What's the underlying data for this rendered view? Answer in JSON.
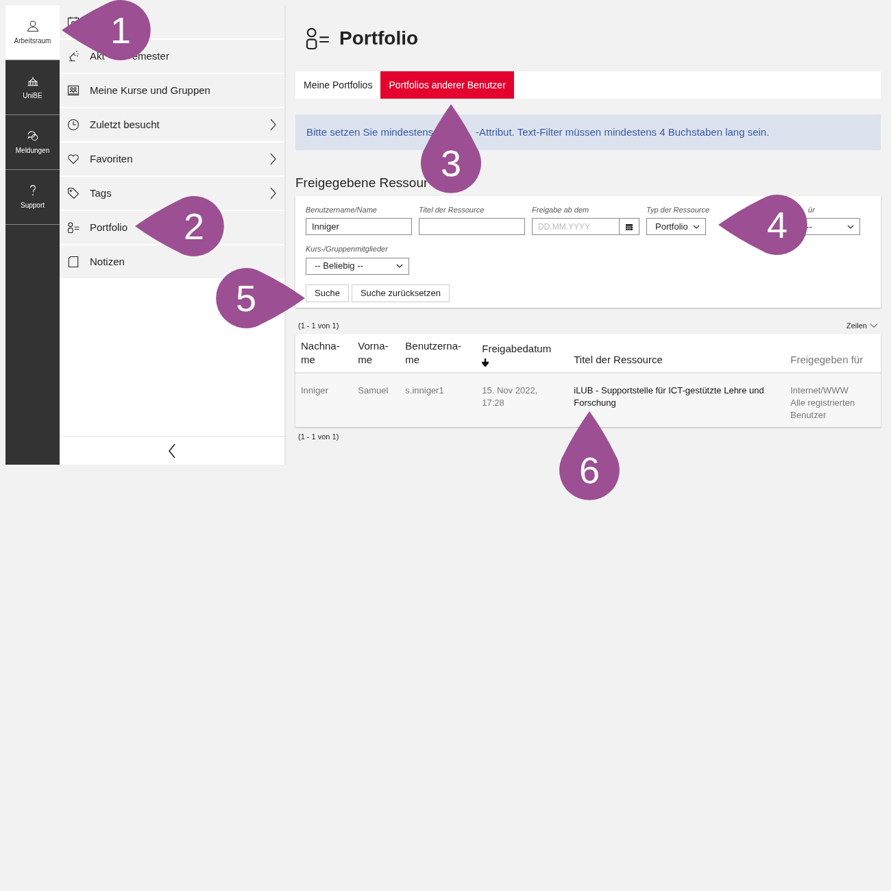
{
  "rail": [
    {
      "label": "Arbeitsraum",
      "selected": true
    },
    {
      "label": "UniBE",
      "selected": false
    },
    {
      "label": "Meldungen",
      "selected": false
    },
    {
      "label": "Support",
      "selected": false
    }
  ],
  "menu": [
    {
      "submenu": false
    },
    {
      "label_parts": [
        "Akt",
        "emester"
      ],
      "submenu": false
    },
    {
      "label_parts": [
        "Meine Kurse und Gruppen"
      ],
      "submenu": false
    },
    {
      "label_parts": [
        "Zuletzt besucht"
      ],
      "submenu": true
    },
    {
      "label_parts": [
        "Favoriten"
      ],
      "submenu": true
    },
    {
      "label_parts": [
        "Tags"
      ],
      "submenu": true
    },
    {
      "label_parts": [
        "Portfolio"
      ],
      "submenu": false
    },
    {
      "label_parts": [
        "Notizen"
      ],
      "submenu": false
    }
  ],
  "page_title": "Portfolio",
  "tabs": [
    {
      "label": "Meine Portfolios",
      "selected": false
    },
    {
      "label": "Portfolios anderer Benutzer",
      "selected": true
    }
  ],
  "alert": {
    "text_parts": [
      "Bitte setzen Sie mindestens",
      "-Attribut. Text-Filter müssen mindestens 4 Buchstaben lang sein."
    ]
  },
  "section_title": "Freigegebene Ressour",
  "filters": [
    {
      "kind": "text",
      "label": "Benutzername/Name",
      "value": "Inniger"
    },
    {
      "kind": "text",
      "label": "Titel der Ressource"
    },
    {
      "kind": "date",
      "label": "Freigabe ab dem",
      "placeholder": "DD.MM.YYYY"
    },
    {
      "kind": "select",
      "label": "Typ der Ressource",
      "value": "Portfolio"
    },
    {
      "kind": "select",
      "label": "ür",
      "value": "--"
    },
    {
      "kind": "select",
      "label": "Kurs-/Gruppenmitglieder",
      "value": "-- Beliebig --"
    }
  ],
  "buttons": [
    "Suche",
    "Suche zurücksetzen"
  ],
  "table": {
    "count_top": "(1 - 1 von 1)",
    "rows_menu": "Zeilen",
    "count_bottom": "(1 - 1 von 1)",
    "columns": [
      {
        "label": "Nachna-\nme",
        "sorted": false
      },
      {
        "label": "Vorna-\nme",
        "sorted": false
      },
      {
        "label": "Benutzerna-\nme",
        "sorted": false
      },
      {
        "label": "Freigabedatum",
        "sorted": true
      },
      {
        "label": "Titel der Ressource",
        "sorted": false
      },
      {
        "label": "Freigegeben für",
        "sorted": false
      }
    ],
    "rows": [
      [
        "Inniger",
        "Samuel",
        "s.inniger1",
        "15. Nov 2022,\n17:28",
        "iLUB - Supportstelle für ICT-gestützte Lehre und Forschung",
        "Internet/WWW\nAlle registrierten\nBenutzer"
      ]
    ]
  },
  "callouts": [
    "1",
    "2",
    "3",
    "4",
    "5",
    "6"
  ]
}
